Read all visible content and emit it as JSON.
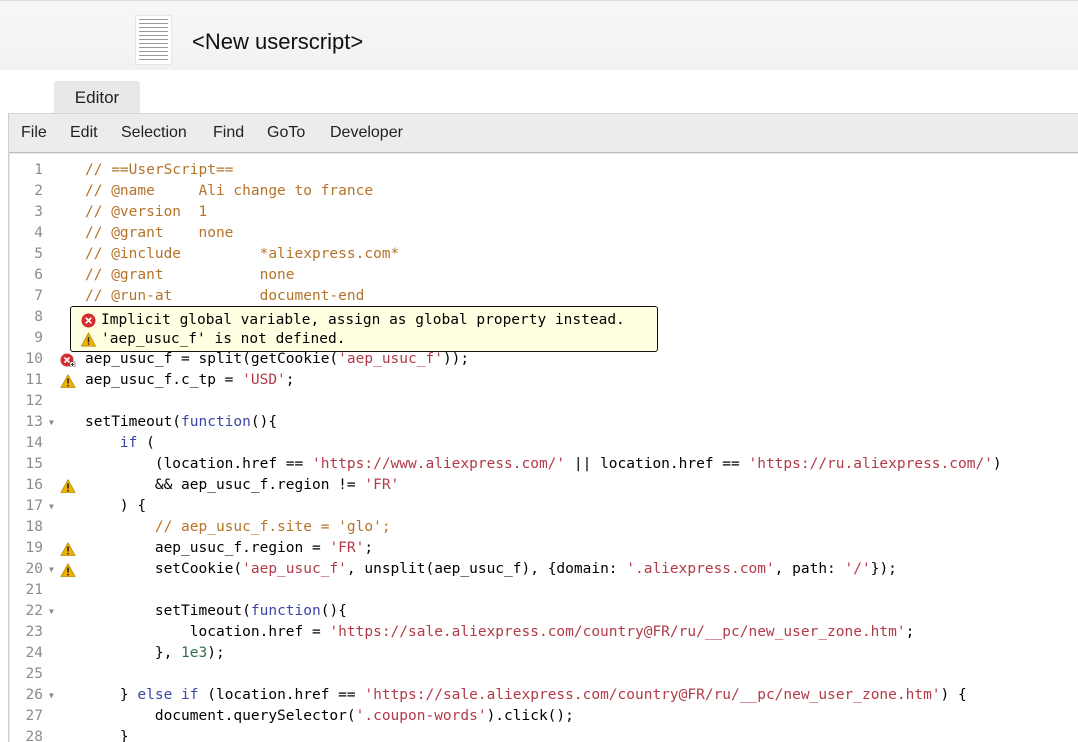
{
  "window": {
    "title": "<New userscript>",
    "logo": "userscript-logo-icon"
  },
  "tabs": [
    {
      "label": "Editor",
      "active": true
    }
  ],
  "menu": [
    "File",
    "Edit",
    "Selection",
    "Find",
    "GoTo",
    "Developer"
  ],
  "colors": {
    "comment": "#b5732a",
    "string": "#b23a49",
    "keyword": "#3b45a8",
    "number": "#2f6f48",
    "error": "#d32f2f",
    "warning": "#f2b200",
    "tooltip_bg": "#ffffe1"
  },
  "tooltip": {
    "messages": [
      {
        "icon": "error-icon",
        "text": "Implicit global variable, assign as global property instead."
      },
      {
        "icon": "warning-icon",
        "text": "'aep_usuc_f' is not defined."
      }
    ]
  },
  "code": [
    {
      "n": "1",
      "fold": false,
      "marker": null,
      "seg": [
        [
          "c",
          "// ==UserScript=="
        ]
      ]
    },
    {
      "n": "2",
      "fold": false,
      "marker": null,
      "seg": [
        [
          "c",
          "// @name     Ali change to france"
        ]
      ]
    },
    {
      "n": "3",
      "fold": false,
      "marker": null,
      "seg": [
        [
          "c",
          "// @version  1"
        ]
      ]
    },
    {
      "n": "4",
      "fold": false,
      "marker": null,
      "seg": [
        [
          "c",
          "// @grant    none"
        ]
      ]
    },
    {
      "n": "5",
      "fold": false,
      "marker": null,
      "seg": [
        [
          "c",
          "// @include         *aliexpress.com*"
        ]
      ]
    },
    {
      "n": "6",
      "fold": false,
      "marker": null,
      "seg": [
        [
          "c",
          "// @grant           none"
        ]
      ]
    },
    {
      "n": "7",
      "fold": false,
      "marker": null,
      "seg": [
        [
          "c",
          "// @run-at          document-end"
        ]
      ]
    },
    {
      "n": "8",
      "fold": false,
      "marker": null,
      "seg": []
    },
    {
      "n": "9",
      "fold": false,
      "marker": null,
      "seg": []
    },
    {
      "n": "10",
      "fold": false,
      "marker": "error",
      "seg": [
        [
          "p",
          "aep_usuc_f = split(getCookie("
        ],
        [
          "s",
          "'aep_usuc_f'"
        ],
        [
          "p",
          "));"
        ]
      ]
    },
    {
      "n": "11",
      "fold": false,
      "marker": "warning",
      "seg": [
        [
          "p",
          "aep_usuc_f.c_tp = "
        ],
        [
          "s",
          "'USD'"
        ],
        [
          "p",
          ";"
        ]
      ]
    },
    {
      "n": "12",
      "fold": false,
      "marker": null,
      "seg": []
    },
    {
      "n": "13",
      "fold": true,
      "marker": null,
      "seg": [
        [
          "p",
          "setTimeout("
        ],
        [
          "k",
          "function"
        ],
        [
          "p",
          "(){"
        ]
      ]
    },
    {
      "n": "14",
      "fold": false,
      "marker": null,
      "seg": [
        [
          "p",
          "    "
        ],
        [
          "k",
          "if"
        ],
        [
          "p",
          " ("
        ]
      ]
    },
    {
      "n": "15",
      "fold": false,
      "marker": null,
      "seg": [
        [
          "p",
          "        (location.href == "
        ],
        [
          "s",
          "'https://www.aliexpress.com/'"
        ],
        [
          "p",
          " || location.href == "
        ],
        [
          "s",
          "'https://ru.aliexpress.com/'"
        ],
        [
          "p",
          ")"
        ]
      ]
    },
    {
      "n": "16",
      "fold": false,
      "marker": "warning",
      "seg": [
        [
          "p",
          "        && aep_usuc_f.region != "
        ],
        [
          "s",
          "'FR'"
        ]
      ]
    },
    {
      "n": "17",
      "fold": true,
      "marker": null,
      "seg": [
        [
          "p",
          "    ) {"
        ]
      ]
    },
    {
      "n": "18",
      "fold": false,
      "marker": null,
      "seg": [
        [
          "p",
          "        "
        ],
        [
          "c",
          "// aep_usuc_f.site = 'glo';"
        ]
      ]
    },
    {
      "n": "19",
      "fold": false,
      "marker": "warning",
      "seg": [
        [
          "p",
          "        aep_usuc_f.region = "
        ],
        [
          "s",
          "'FR'"
        ],
        [
          "p",
          ";"
        ]
      ]
    },
    {
      "n": "20",
      "fold": true,
      "marker": "warning",
      "seg": [
        [
          "p",
          "        setCookie("
        ],
        [
          "s",
          "'aep_usuc_f'"
        ],
        [
          "p",
          ", unsplit(aep_usuc_f), {domain: "
        ],
        [
          "s",
          "'.aliexpress.com'"
        ],
        [
          "p",
          ", path: "
        ],
        [
          "s",
          "'/'"
        ],
        [
          "p",
          "});"
        ]
      ]
    },
    {
      "n": "21",
      "fold": false,
      "marker": null,
      "seg": []
    },
    {
      "n": "22",
      "fold": true,
      "marker": null,
      "seg": [
        [
          "p",
          "        setTimeout("
        ],
        [
          "k",
          "function"
        ],
        [
          "p",
          "(){"
        ]
      ]
    },
    {
      "n": "23",
      "fold": false,
      "marker": null,
      "seg": [
        [
          "p",
          "            location.href = "
        ],
        [
          "s",
          "'https://sale.aliexpress.com/country@FR/ru/__pc/new_user_zone.htm'"
        ],
        [
          "p",
          ";"
        ]
      ]
    },
    {
      "n": "24",
      "fold": false,
      "marker": null,
      "seg": [
        [
          "p",
          "        }, "
        ],
        [
          "n",
          "1e3"
        ],
        [
          "p",
          ");"
        ]
      ]
    },
    {
      "n": "25",
      "fold": false,
      "marker": null,
      "seg": []
    },
    {
      "n": "26",
      "fold": true,
      "marker": null,
      "seg": [
        [
          "p",
          "    } "
        ],
        [
          "k",
          "else if"
        ],
        [
          "p",
          " (location.href == "
        ],
        [
          "s",
          "'https://sale.aliexpress.com/country@FR/ru/__pc/new_user_zone.htm'"
        ],
        [
          "p",
          ") {"
        ]
      ]
    },
    {
      "n": "27",
      "fold": false,
      "marker": null,
      "seg": [
        [
          "p",
          "        document.querySelector("
        ],
        [
          "s",
          "'.coupon-words'"
        ],
        [
          "p",
          ").click();"
        ]
      ]
    },
    {
      "n": "28",
      "fold": false,
      "marker": null,
      "seg": [
        [
          "p",
          "    }"
        ]
      ]
    }
  ]
}
